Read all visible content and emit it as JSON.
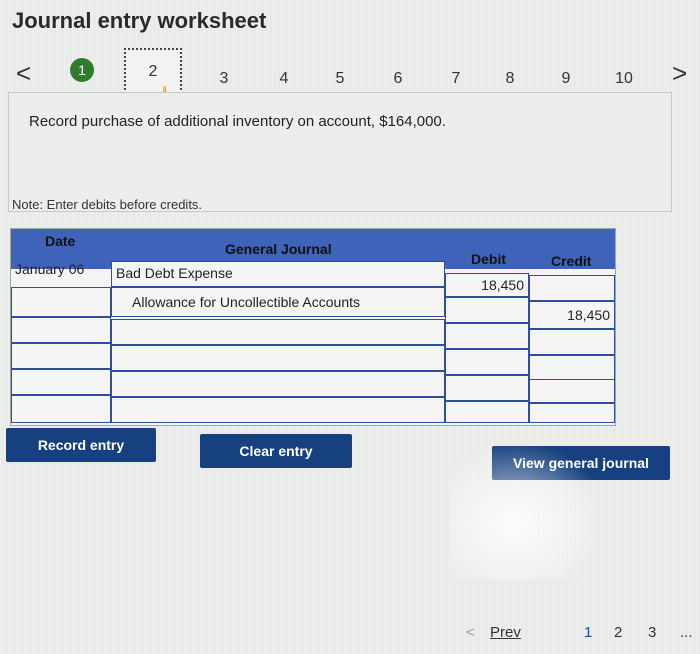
{
  "title": "Journal entry worksheet",
  "nav": {
    "prev_arrow": "<",
    "next_arrow": ">",
    "steps": [
      "1",
      "2",
      "3",
      "4",
      "5",
      "6",
      "7",
      "8",
      "9",
      "10"
    ],
    "completed_step": "1",
    "current_step": "2"
  },
  "instruction": "Record purchase of additional inventory on account, $164,000.",
  "note": "Note: Enter debits before credits.",
  "journal": {
    "headers": {
      "date": "Date",
      "general_journal": "General Journal",
      "debit": "Debit",
      "credit": "Credit"
    },
    "rows": [
      {
        "date": "January 06",
        "account": "Bad Debt Expense",
        "debit": "18,450",
        "credit": ""
      },
      {
        "date": "",
        "account": "Allowance for Uncollectible Accounts",
        "debit": "",
        "credit": "18,450"
      },
      {
        "date": "",
        "account": "",
        "debit": "",
        "credit": ""
      },
      {
        "date": "",
        "account": "",
        "debit": "",
        "credit": ""
      },
      {
        "date": "",
        "account": "",
        "debit": "",
        "credit": ""
      },
      {
        "date": "",
        "account": "",
        "debit": "",
        "credit": ""
      }
    ]
  },
  "buttons": {
    "record": "Record entry",
    "clear": "Clear entry",
    "view": "View general journal"
  },
  "pager": {
    "prev": "Prev",
    "pages": [
      "1",
      "2",
      "3"
    ],
    "more": "..."
  },
  "colors": {
    "header_blue": "#3e63b8",
    "button_navy": "#16407f",
    "done_green": "#2f7d2b"
  }
}
